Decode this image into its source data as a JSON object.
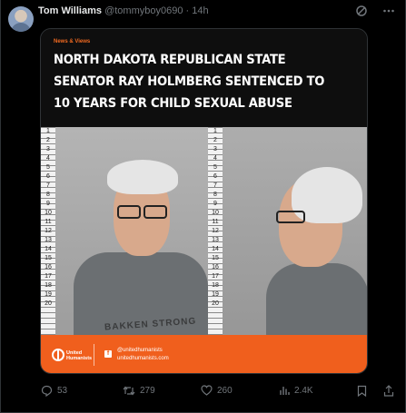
{
  "post": {
    "author_name": "Tom Williams",
    "author_handle": "@tommyboy0690",
    "separator": "·",
    "time": "14h",
    "card": {
      "tag": "News & Views",
      "headline": "North Dakota Republican State Senator Ray Holmberg Sentenced to 10 Years for Child Sexual Abuse",
      "ruler_numbers": [
        "1",
        "2",
        "3",
        "4",
        "5",
        "6",
        "7",
        "8",
        "9",
        "10",
        "11",
        "12",
        "13",
        "14",
        "15",
        "16",
        "17",
        "18",
        "19",
        "20"
      ],
      "shirt_text": "BAKKEN STRONG",
      "footer": {
        "logo_text": "United Humanists",
        "social_handle": "@unitedhumanists",
        "website": "unitedhumanists.com"
      }
    },
    "actions": {
      "replies": "53",
      "reposts": "279",
      "likes": "260",
      "views": "2.4K"
    }
  },
  "icons": [
    "grok-icon",
    "more-icon",
    "reply-icon",
    "repost-icon",
    "like-icon",
    "views-icon",
    "bookmark-icon",
    "share-icon"
  ],
  "colors": {
    "background": "#000000",
    "muted": "#71767b",
    "accent": "#f05f1d",
    "tag": "#f26a21"
  }
}
